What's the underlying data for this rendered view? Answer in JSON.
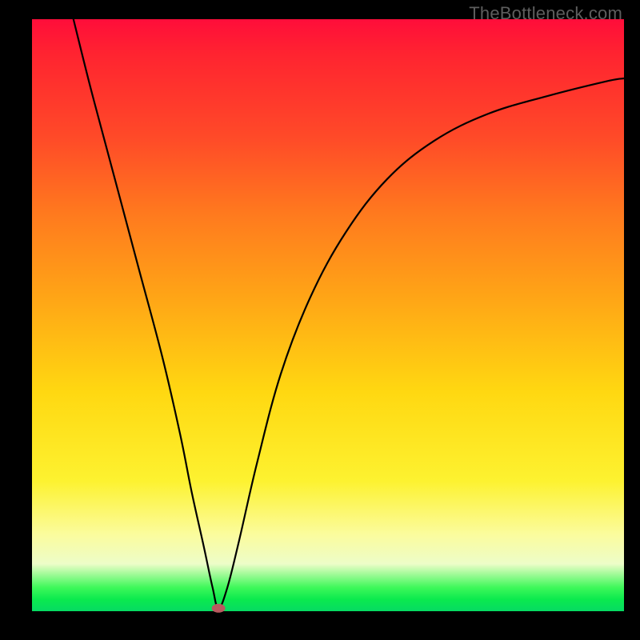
{
  "watermark": "TheBottleneck.com",
  "chart_data": {
    "type": "line",
    "title": "",
    "xlabel": "",
    "ylabel": "",
    "xlim": [
      0,
      100
    ],
    "ylim": [
      0,
      100
    ],
    "grid": false,
    "legend": false,
    "series": [
      {
        "name": "curve",
        "x": [
          7,
          10,
          14,
          18,
          22,
          25,
          27,
          29,
          30.5,
          31.5,
          33,
          35,
          38,
          42,
          47,
          53,
          60,
          68,
          77,
          87,
          97,
          100
        ],
        "y": [
          100,
          88,
          73,
          58,
          43,
          30,
          20,
          11,
          4,
          0.5,
          4,
          12,
          25,
          40,
          53,
          64,
          73,
          79.5,
          84,
          87,
          89.5,
          90
        ]
      }
    ],
    "marker": {
      "x": 31.5,
      "y": 0.5,
      "shape": "ellipse",
      "color": "#b95a5f"
    },
    "gradient_stops": [
      {
        "pos": 0.0,
        "color": "#ff0d3a"
      },
      {
        "pos": 0.2,
        "color": "#ff4a28"
      },
      {
        "pos": 0.47,
        "color": "#ffa516"
      },
      {
        "pos": 0.78,
        "color": "#fdf230"
      },
      {
        "pos": 0.92,
        "color": "#edfdc8"
      },
      {
        "pos": 0.97,
        "color": "#0bea4e"
      },
      {
        "pos": 1.0,
        "color": "#06da63"
      }
    ]
  }
}
